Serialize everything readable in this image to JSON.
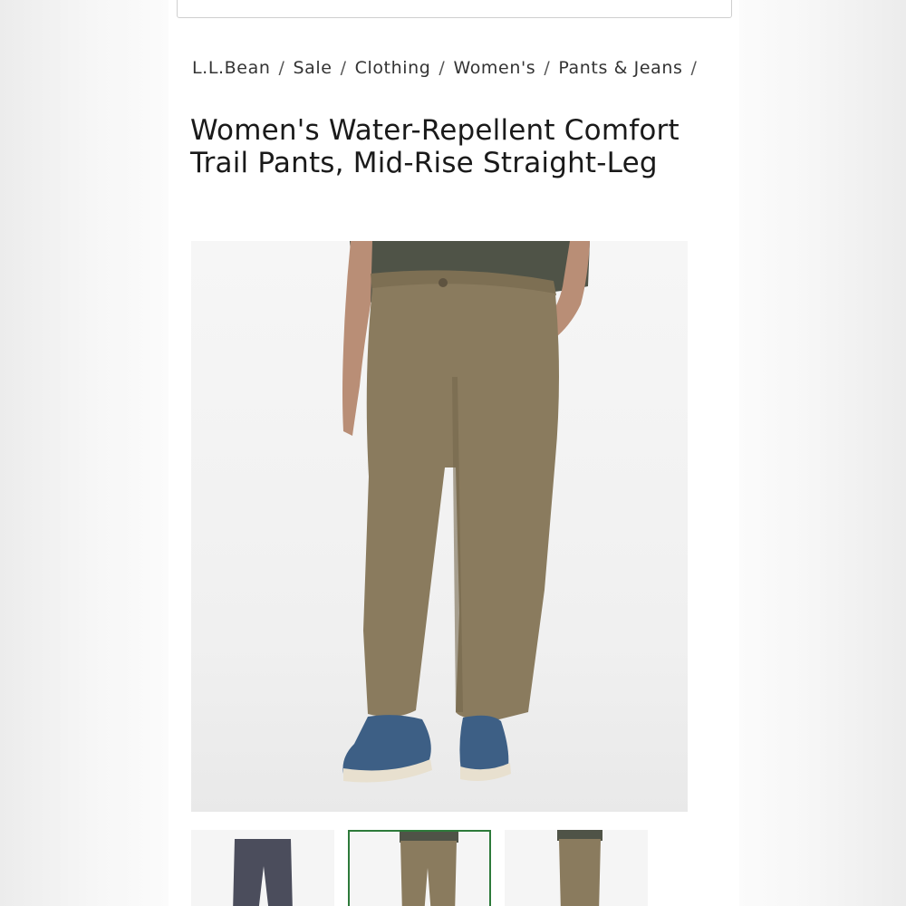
{
  "breadcrumb": {
    "items": [
      "L.L.Bean",
      "Sale",
      "Clothing",
      "Women's",
      "Pants & Jeans"
    ],
    "separator": "/"
  },
  "product": {
    "title": "Women's Water-Repellent Comfort Trail Pants, Mid-Rise Straight-Leg",
    "main_image": "khaki-pants-model-photo"
  },
  "thumbnails": [
    {
      "image": "gray-pants-flat-photo",
      "active": false
    },
    {
      "image": "khaki-pants-front-photo",
      "active": true
    },
    {
      "image": "khaki-pants-side-photo",
      "active": false
    }
  ],
  "colors": {
    "pants": "#8a7b5e",
    "shirt": "#4f5347",
    "shoe": "#3d5f85",
    "active_thumb_border": "#2d7a3a"
  }
}
